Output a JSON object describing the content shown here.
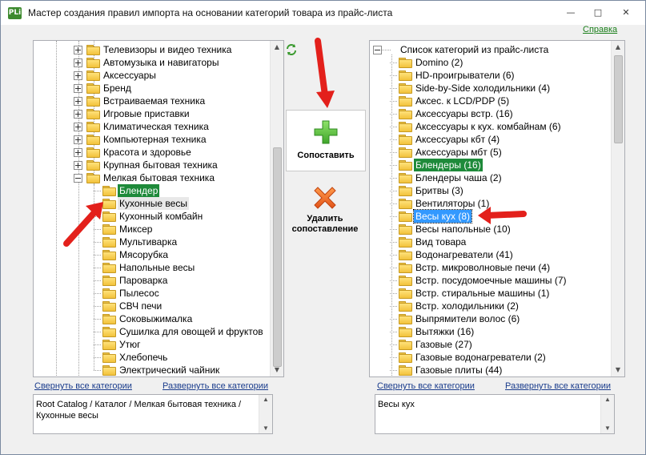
{
  "window": {
    "title": "Мастер создания правил импорта на основании категорий товара из прайс-листа",
    "app_icon": "PLi",
    "help_link": "Справка"
  },
  "left_tree": {
    "items": [
      {
        "label": "Телевизоры и видео техника",
        "level": 0,
        "expander": "plus"
      },
      {
        "label": "Автомузыка и навигаторы",
        "level": 0,
        "expander": "plus"
      },
      {
        "label": "Аксессуары",
        "level": 0,
        "expander": "plus"
      },
      {
        "label": "Бренд",
        "level": 0,
        "expander": "plus"
      },
      {
        "label": "Встраиваемая техника",
        "level": 0,
        "expander": "plus"
      },
      {
        "label": "Игровые приставки",
        "level": 0,
        "expander": "plus"
      },
      {
        "label": "Климатическая техника",
        "level": 0,
        "expander": "plus"
      },
      {
        "label": "Компьютерная техника",
        "level": 0,
        "expander": "plus"
      },
      {
        "label": "Красота и здоровье",
        "level": 0,
        "expander": "plus"
      },
      {
        "label": "Крупная бытовая техника",
        "level": 0,
        "expander": "plus"
      },
      {
        "label": "Мелкая бытовая техника",
        "level": 0,
        "expander": "minus"
      },
      {
        "label": "Блендер",
        "level": 1,
        "state": "green"
      },
      {
        "label": "Кухонные весы",
        "level": 1,
        "state": "hover"
      },
      {
        "label": "Кухонный комбайн",
        "level": 1
      },
      {
        "label": "Миксер",
        "level": 1
      },
      {
        "label": "Мультиварка",
        "level": 1
      },
      {
        "label": "Мясорубка",
        "level": 1
      },
      {
        "label": "Напольные весы",
        "level": 1
      },
      {
        "label": "Пароварка",
        "level": 1
      },
      {
        "label": "Пылесос",
        "level": 1
      },
      {
        "label": "СВЧ печи",
        "level": 1
      },
      {
        "label": "Соковыжималка",
        "level": 1
      },
      {
        "label": "Сушилка для овощей и фруктов",
        "level": 1
      },
      {
        "label": "Утюг",
        "level": 1
      },
      {
        "label": "Хлебопечь",
        "level": 1
      },
      {
        "label": "Электрический чайник",
        "level": 1
      }
    ],
    "scroll": 0.72
  },
  "right_tree": {
    "root_label": "Список категорий из прайс-листа",
    "items": [
      {
        "label": "Domino (2)"
      },
      {
        "label": "HD-проигрыватели (6)"
      },
      {
        "label": "Side-by-Side холодильники (4)"
      },
      {
        "label": "Аксес. к LCD/PDP (5)"
      },
      {
        "label": "Аксессуары встр. (16)"
      },
      {
        "label": "Аксессуары к кух. комбайнам (6)"
      },
      {
        "label": "Аксессуары кбт (4)"
      },
      {
        "label": "Аксессуары мбт (5)"
      },
      {
        "label": "Блендеры (16)",
        "state": "green"
      },
      {
        "label": "Блендеры чаша (2)"
      },
      {
        "label": "Бритвы (3)"
      },
      {
        "label": "Вентиляторы (1)"
      },
      {
        "label": "Весы кух (8)",
        "state": "blue"
      },
      {
        "label": "Весы напольные (10)"
      },
      {
        "label": "Вид товара"
      },
      {
        "label": "Водонагреватели (41)"
      },
      {
        "label": "Встр. микроволновые печи (4)"
      },
      {
        "label": "Встр. посудомоечные машины (7)"
      },
      {
        "label": "Встр. стиральные машины (1)"
      },
      {
        "label": "Встр. холодильники (2)"
      },
      {
        "label": "Выпрямители волос (6)"
      },
      {
        "label": "Вытяжки (16)"
      },
      {
        "label": "Газовые (27)"
      },
      {
        "label": "Газовые водонагреватели (2)"
      },
      {
        "label": "Газовые плиты (44)"
      }
    ],
    "scroll": 0.0
  },
  "buttons": {
    "match_label": "Сопоставить",
    "delete_label_1": "Удалить",
    "delete_label_2": "сопоставление"
  },
  "left_links": {
    "collapse": "Свернуть все категории",
    "expand": "Развернуть все категории"
  },
  "right_links": {
    "collapse": "Свернуть все категории",
    "expand": "Развернуть все категории"
  },
  "left_path": {
    "text": "Root Catalog / Каталог / Мелкая бытовая техника / Кухонные весы"
  },
  "right_path": {
    "text": "Весы кух"
  },
  "colors": {
    "selection_green": "#1e8a3a",
    "selection_blue": "#3399ff",
    "link_blue": "#1a3c8c",
    "help_green": "#1a7f1a",
    "annotation_red": "#e3201b"
  },
  "icons": {
    "refresh": "refresh-icon",
    "match": "plus-icon",
    "delete": "cross-icon",
    "folder": "folder-icon"
  }
}
